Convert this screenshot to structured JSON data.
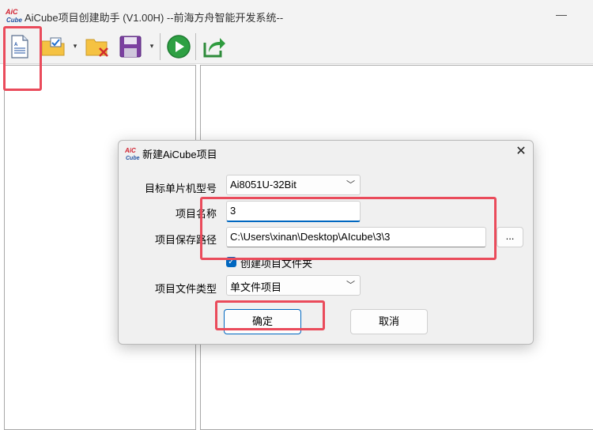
{
  "window": {
    "title": "AiCube项目创建助手 (V1.00H) --前海方舟智能开发系统--",
    "logo_text_top": "AiC",
    "logo_text_bottom": "Cube",
    "minimize_glyph": "—"
  },
  "toolbar": {
    "items": [
      {
        "name": "new-project-icon"
      },
      {
        "name": "open-project-icon"
      },
      {
        "name": "delete-project-icon"
      },
      {
        "name": "save-icon"
      },
      {
        "name": "run-icon"
      },
      {
        "name": "export-icon"
      }
    ],
    "dropdown_glyph": "▾"
  },
  "dialog": {
    "title": "新建AiCube项目",
    "close_glyph": "✕",
    "fields": {
      "mcu_label": "目标单片机型号",
      "mcu_value": "Ai8051U-32Bit",
      "name_label": "项目名称",
      "name_value": "3",
      "path_label": "项目保存路径",
      "path_value": "C:\\Users\\xinan\\Desktop\\AIcube\\3\\3",
      "browse_label": "...",
      "create_folder_label": "创建项目文件夹",
      "create_folder_checked": true,
      "type_label": "项目文件类型",
      "type_value": "单文件项目"
    },
    "ok_label": "确定",
    "cancel_label": "取消"
  },
  "colors": {
    "accent": "#0067c0",
    "annotation": "#ea4b5b",
    "logo_red": "#d1202f",
    "logo_blue": "#1e4fa0"
  }
}
